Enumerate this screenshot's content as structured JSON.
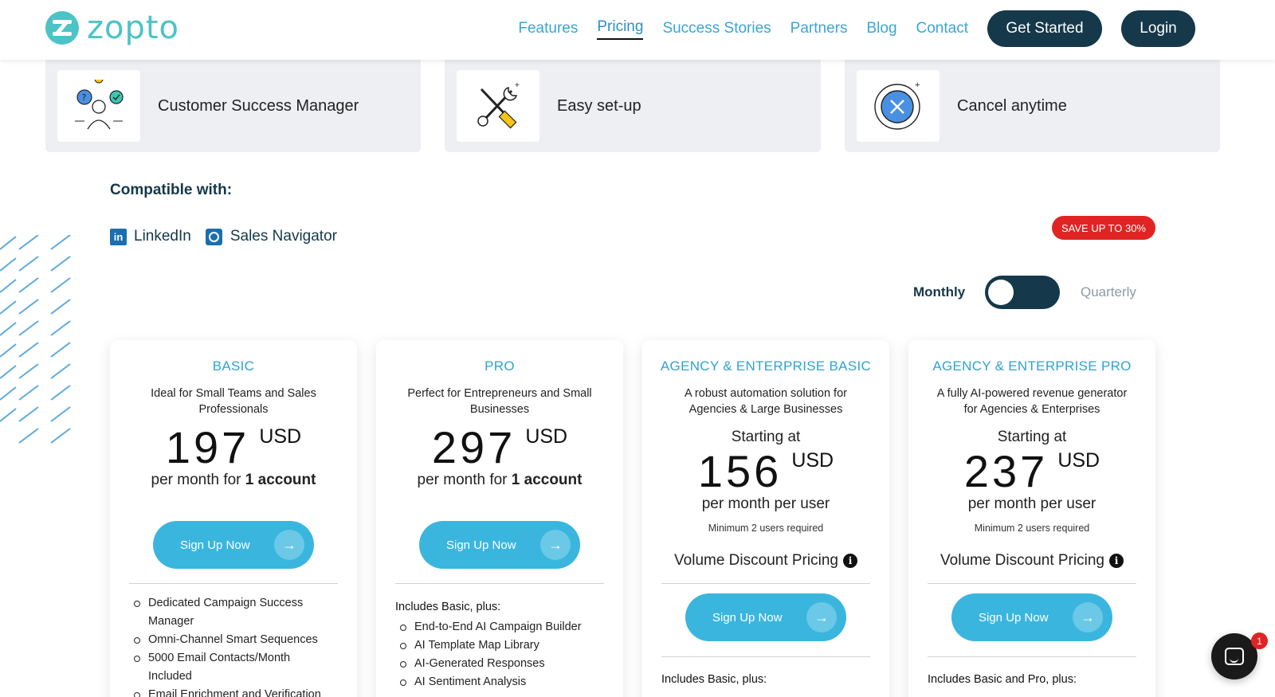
{
  "brand": {
    "name": "zopto",
    "color": "#4cc3c6"
  },
  "nav": {
    "links": [
      "Features",
      "Pricing",
      "Success Stories",
      "Partners",
      "Blog",
      "Contact"
    ],
    "active": "Pricing",
    "get_started": "Get Started",
    "login": "Login"
  },
  "features": [
    {
      "label": "Customer Success Manager",
      "icon": "customer-success-icon"
    },
    {
      "label": "Easy set-up",
      "icon": "tools-icon"
    },
    {
      "label": "Cancel anytime",
      "icon": "cancel-icon"
    }
  ],
  "compatible": {
    "title": "Compatible with:",
    "items": [
      "LinkedIn",
      "Sales Navigator"
    ]
  },
  "billing": {
    "save_badge": "SAVE UP TO 30%",
    "monthly": "Monthly",
    "quarterly": "Quarterly",
    "selected": "Monthly"
  },
  "plans": [
    {
      "title": "BASIC",
      "desc": "Ideal for Small Teams and Sales Professionals",
      "price": "197",
      "currency": "USD",
      "per_prefix": "per month for ",
      "per_bold": "1 account",
      "cta": "Sign Up Now",
      "features": [
        "Dedicated Campaign Success Manager",
        "Omni-Channel Smart Sequences",
        "5000 Email Contacts/Month Included",
        "Email Enrichment and Verification"
      ]
    },
    {
      "title": "PRO",
      "desc": "Perfect for Entrepreneurs and Small Businesses",
      "price": "297",
      "currency": "USD",
      "per_prefix": "per month for ",
      "per_bold": "1 account",
      "cta": "Sign Up Now",
      "includes": "Includes Basic, plus:",
      "features": [
        "End-to-End AI Campaign Builder",
        "AI Template Map Library",
        "AI-Generated Responses",
        "AI Sentiment Analysis"
      ]
    },
    {
      "title": "AGENCY & ENTERPRISE BASIC",
      "desc": "A robust automation solution for Agencies & Large Businesses",
      "starting": "Starting at",
      "price": "156",
      "currency": "USD",
      "per": "per month per user",
      "min_users": "Minimum 2 users required",
      "volume": "Volume Discount Pricing",
      "cta": "Sign Up Now",
      "includes": "Includes Basic, plus:"
    },
    {
      "title": "AGENCY & ENTERPRISE PRO",
      "desc": "A fully AI-powered revenue generator for Agencies & Enterprises",
      "starting": "Starting at",
      "price": "237",
      "currency": "USD",
      "per": "per month per user",
      "min_users": "Minimum 2 users required",
      "volume": "Volume Discount Pricing",
      "cta": "Sign Up Now",
      "includes": "Includes Basic and Pro, plus:"
    }
  ],
  "chat": {
    "unread": "1"
  },
  "colors": {
    "accent": "#3ab6de",
    "dark": "#15384a",
    "save": "#e02424"
  }
}
